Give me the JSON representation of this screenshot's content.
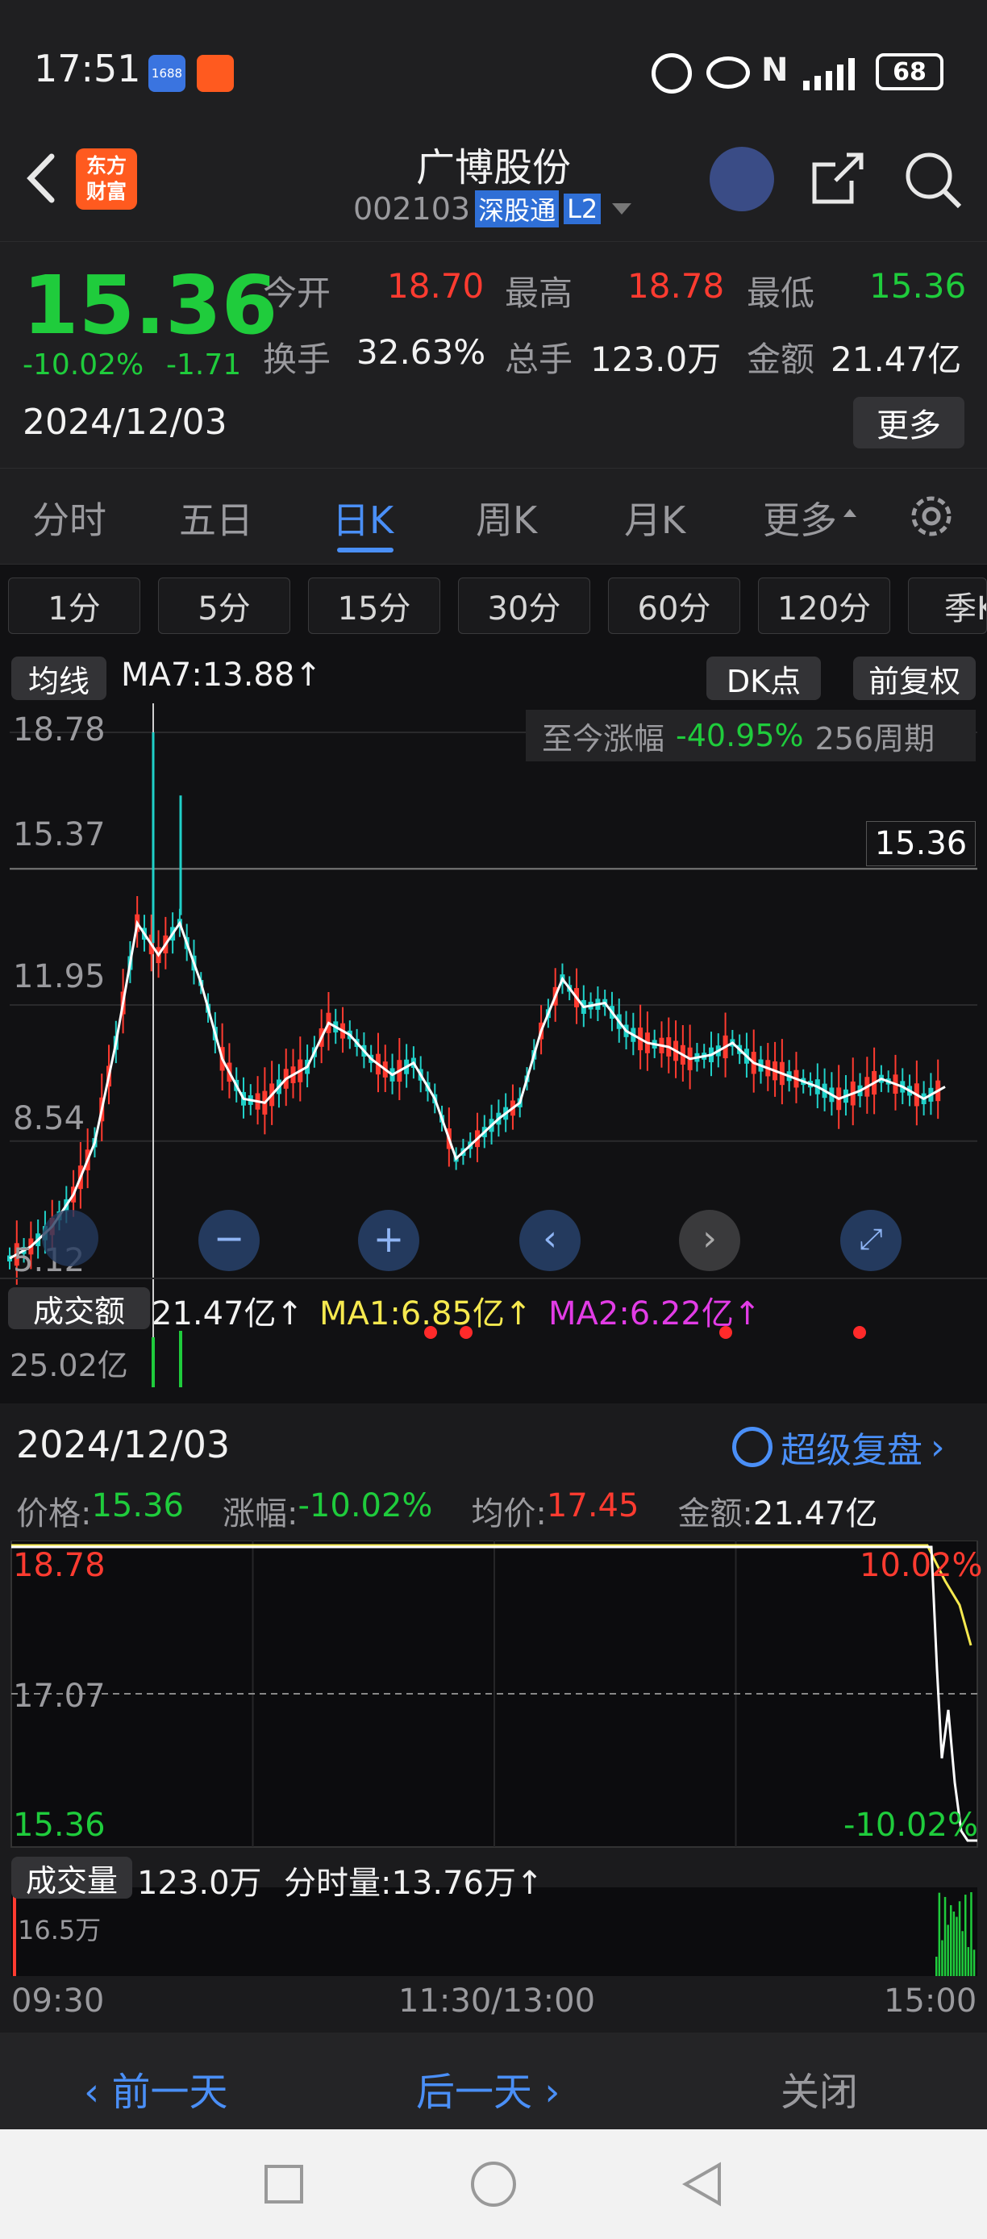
{
  "status_bar": {
    "time": "17:51",
    "app_icon_1": "1688",
    "battery": "68"
  },
  "nav": {
    "back_icon": "chevron-left-icon",
    "logo_text_1": "东方",
    "logo_text_2": "财富",
    "title": "广博股份",
    "code": "002103",
    "badge_connect": "深股通",
    "badge_level": "L2"
  },
  "quote": {
    "price": "15.36",
    "change_pct": "-10.02%",
    "change": "-1.71",
    "date": "2024/12/03",
    "open_label": "今开",
    "open": "18.70",
    "high_label": "最高",
    "high": "18.78",
    "low_label": "最低",
    "low": "15.36",
    "turnover_label": "换手",
    "turnover": "32.63%",
    "volume_label": "总手",
    "volume": "123.0万",
    "amount_label": "金额",
    "amount": "21.47亿",
    "more_button": "更多"
  },
  "tabs": [
    "分时",
    "五日",
    "日K",
    "周K",
    "月K",
    "更多"
  ],
  "active_tab": "日K",
  "kline_intervals": [
    "1分",
    "5分",
    "15分",
    "30分",
    "60分",
    "120分",
    "季K"
  ],
  "kchart": {
    "ma_selector": "均线",
    "ma7": "MA7:13.88↑",
    "dk_button": "DK点",
    "adjust_button": "前复权",
    "y_ticks": [
      "18.78",
      "15.37",
      "11.95",
      "8.54",
      "5.12"
    ],
    "since_label": "至今涨幅",
    "since_value": "-40.95%",
    "since_periods": "256周期",
    "price_tag": "15.36",
    "vol_selector": "成交额",
    "vol_value": "21.47亿↑",
    "vol_ma1": "MA1:6.85亿↑",
    "vol_ma2": "MA2:6.22亿↑",
    "vol_max": "25.02亿"
  },
  "intraday": {
    "date": "2024/12/03",
    "replay": "超级复盘",
    "price_label": "价格:",
    "price": "15.36",
    "chg_label": "涨幅:",
    "chg": "-10.02%",
    "avg_label": "均价:",
    "avg": "17.45",
    "amt_label": "金额:",
    "amt": "21.47亿",
    "y_high": "18.78",
    "y_mid": "17.07",
    "y_low": "15.36",
    "pct_high": "10.02%",
    "pct_low": "-10.02%",
    "vol_selector": "成交量",
    "vol_total": "123.0万",
    "vol_min_label": "分时量:13.76万↑",
    "vol_max": "16.5万",
    "time_start": "09:30",
    "time_mid": "11:30/13:00",
    "time_end": "15:00"
  },
  "bottom": {
    "prev": "前一天",
    "next": "后一天",
    "close": "关闭"
  },
  "colors": {
    "up": "#ff3b30",
    "down": "#1fcc3c",
    "accent": "#4a8ff7",
    "ma": "#f6e94f"
  },
  "chart_data": {
    "type": "line",
    "title": "",
    "ylim": [
      5.12,
      18.78
    ],
    "series": [
      {
        "name": "MA7",
        "values": [
          5.6,
          5.9,
          6.4,
          7.2,
          8.5,
          11.0,
          14.0,
          13.2,
          14.0,
          12.5,
          10.6,
          9.6,
          9.5,
          10.1,
          10.4,
          11.5,
          11.2,
          10.6,
          10.2,
          10.5,
          9.6,
          8.1,
          8.6,
          9.1,
          9.5,
          11.3,
          12.6,
          11.9,
          12.0,
          11.3,
          11.0,
          10.9,
          10.6,
          10.7,
          11.0,
          10.5,
          10.3,
          10.1,
          9.9,
          9.6,
          9.8,
          10.1,
          9.9,
          9.6,
          9.9
        ]
      }
    ]
  }
}
